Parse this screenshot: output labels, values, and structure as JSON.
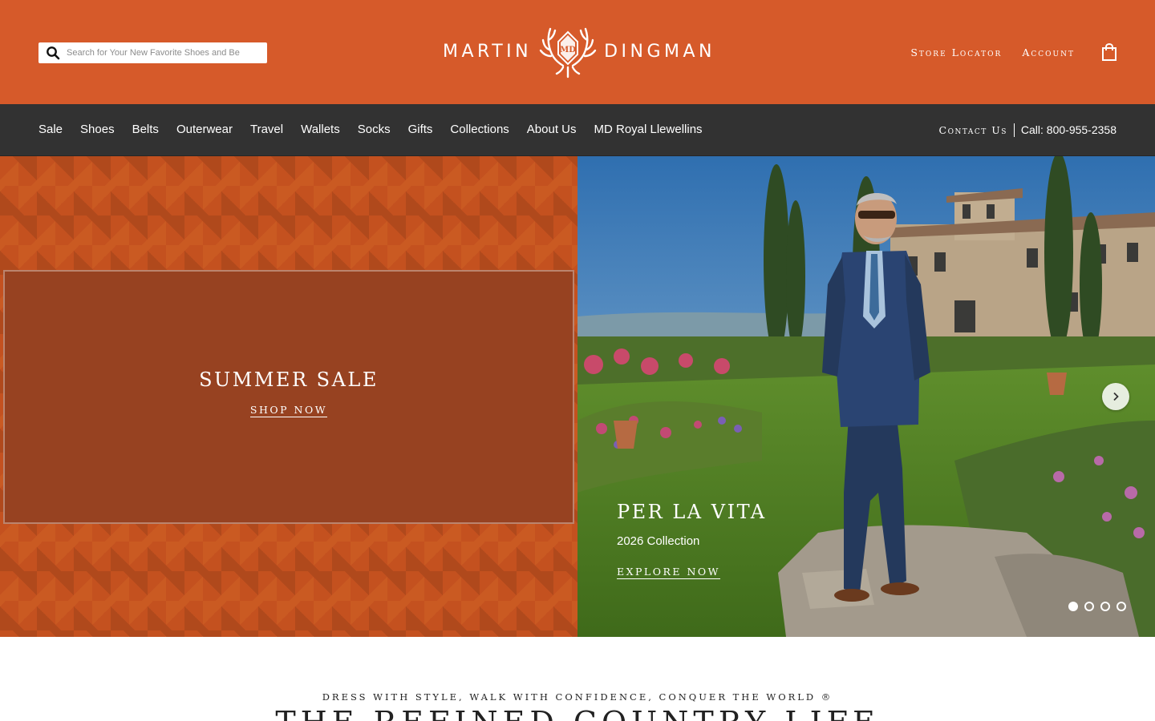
{
  "header": {
    "search_placeholder": "Search for Your New Favorite Shoes and Be",
    "logo_left": "MARTIN",
    "logo_right": "DINGMAN",
    "store_locator": "Store Locator",
    "account": "Account",
    "bag_icon": "shopping-bag-icon"
  },
  "nav": {
    "items": [
      {
        "label": "Sale"
      },
      {
        "label": "Shoes"
      },
      {
        "label": "Belts"
      },
      {
        "label": "Outerwear"
      },
      {
        "label": "Travel"
      },
      {
        "label": "Wallets"
      },
      {
        "label": "Socks"
      },
      {
        "label": "Gifts"
      },
      {
        "label": "Collections"
      },
      {
        "label": "About Us"
      },
      {
        "label": "MD Royal Llewellins"
      }
    ],
    "contact": "Contact Us",
    "phone": "Call: 800-955-2358"
  },
  "promo": {
    "title": "SUMMER SALE",
    "cta": "SHOP NOW"
  },
  "feature": {
    "title": "PER LA VITA",
    "subtitle": "2026 Collection",
    "cta": "EXPLORE NOW",
    "slides_total": 4,
    "active_slide": 1
  },
  "intro": {
    "tagline": "DRESS WITH STYLE, WALK WITH CONFIDENCE, CONQUER THE WORLD ®",
    "title": "THE REFINED COUNTRY LIFE"
  },
  "colors": {
    "header_bg": "#d65a2a",
    "nav_bg": "#323232",
    "promo_box": "#974221"
  }
}
